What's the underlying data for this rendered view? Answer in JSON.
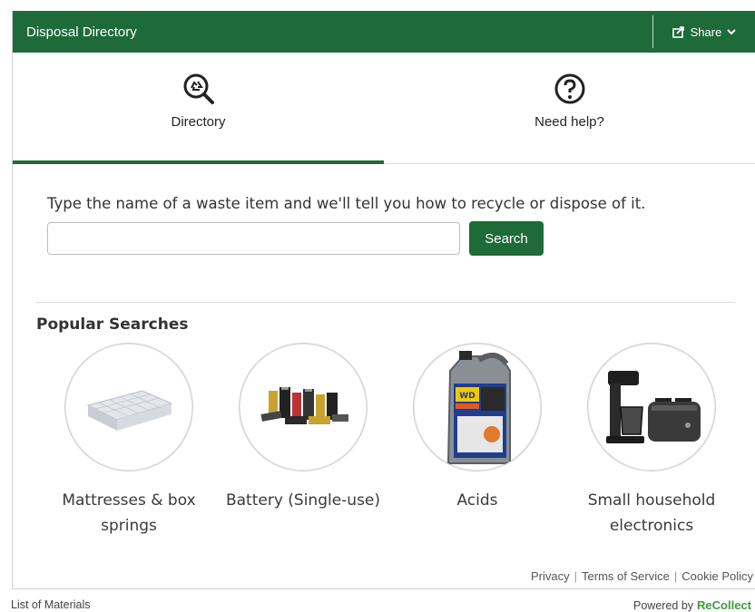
{
  "header": {
    "title": "Disposal Directory",
    "share_label": "Share",
    "bg_color": "#1e6b39"
  },
  "tabs": [
    {
      "label": "Directory",
      "icon": "recycle-search-icon",
      "active": true
    },
    {
      "label": "Need help?",
      "icon": "question-circle-icon",
      "active": false
    }
  ],
  "search": {
    "prompt": "Type the name of a waste item and we'll tell you how to recycle or dispose of it.",
    "value": "",
    "placeholder": "",
    "button_label": "Search"
  },
  "popular": {
    "title": "Popular Searches",
    "items": [
      {
        "label": "Mattresses & box springs",
        "image": "mattress-image"
      },
      {
        "label": "Battery (Single-use)",
        "image": "batteries-image"
      },
      {
        "label": "Acids",
        "image": "wd40-jug-image"
      },
      {
        "label": "Small household electronics",
        "image": "coffee-maker-toaster-image"
      }
    ]
  },
  "legal": {
    "privacy": "Privacy",
    "terms": "Terms of Service",
    "cookie": "Cookie Policy"
  },
  "footer": {
    "left_link": "List of Materials",
    "powered_by": "Powered by",
    "brand": "ReCollect"
  }
}
